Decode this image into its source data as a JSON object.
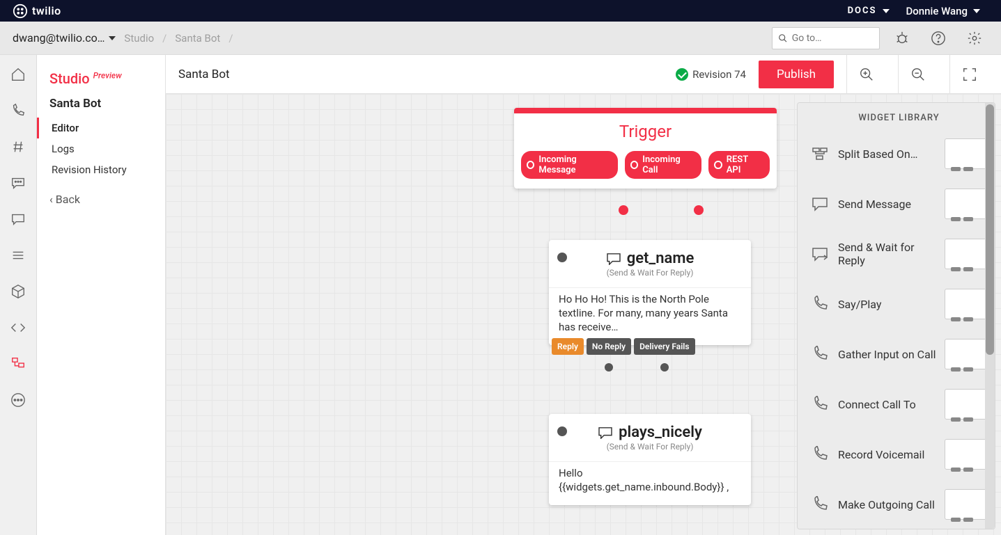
{
  "topbar": {
    "brand": "twilio",
    "docs": "DOCS",
    "user": "Donnie Wang"
  },
  "subbar": {
    "account": "dwang@twilio.co…",
    "crumb1": "Studio",
    "crumb2": "Santa Bot",
    "search_placeholder": "Go to…"
  },
  "sidepanel": {
    "title": "Studio",
    "preview": "Preview",
    "flowname": "Santa Bot",
    "items": [
      "Editor",
      "Logs",
      "Revision History"
    ],
    "back": "‹ Back"
  },
  "canvas_header": {
    "flow": "Santa Bot",
    "revision": "Revision 74",
    "publish": "Publish"
  },
  "trigger": {
    "title": "Trigger",
    "ports": [
      "Incoming Message",
      "Incoming Call",
      "REST API"
    ]
  },
  "node1": {
    "title": "get_name",
    "subtitle": "(Send & Wait For Reply)",
    "body": "Ho Ho Ho! This is the North Pole textline. For many, many years Santa has receive…",
    "outs": [
      "Reply",
      "No Reply",
      "Delivery Fails"
    ]
  },
  "node2": {
    "title": "plays_nicely",
    "subtitle": "(Send & Wait For Reply)",
    "body": "Hello {{widgets.get_name.inbound.Body}} ,"
  },
  "widget_library": {
    "header": "WIDGET LIBRARY",
    "items": [
      "Split Based On…",
      "Send Message",
      "Send & Wait for Reply",
      "Say/Play",
      "Gather Input on Call",
      "Connect Call To",
      "Record Voicemail",
      "Make Outgoing Call"
    ]
  },
  "colors": {
    "accent": "#f22f46",
    "orange": "#e98a2b"
  }
}
